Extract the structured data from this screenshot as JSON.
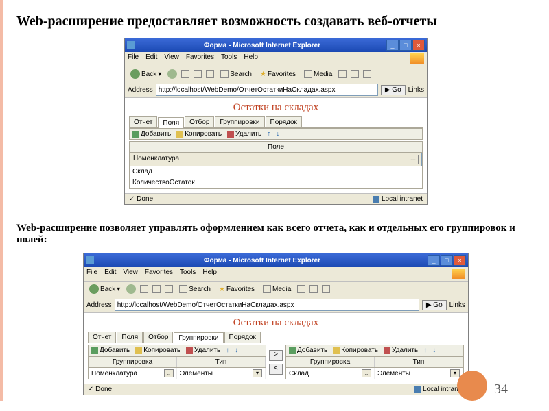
{
  "heading1": "Web-расширение предоставляет возможность создавать веб-отчеты",
  "heading2": "Web-расширение позволяет управлять оформлением как всего отчета, как и отдельных его группировок и полей:",
  "page_number": "34",
  "win1": {
    "title": "Форма - Microsoft Internet Explorer",
    "menu": [
      "File",
      "Edit",
      "View",
      "Favorites",
      "Tools",
      "Help"
    ],
    "toolbar": {
      "back": "Back",
      "search": "Search",
      "favorites": "Favorites",
      "media": "Media"
    },
    "addr_label": "Address",
    "url": "http://localhost/WebDemo/ОтчетОстаткиНаСкладах.aspx",
    "go": "Go",
    "links": "Links",
    "page_title": "Остатки на складах",
    "tabs": [
      "Отчет",
      "Поля",
      "Отбор",
      "Группировки",
      "Порядок"
    ],
    "active_tab": 1,
    "actions": {
      "add": "Добавить",
      "copy": "Копировать",
      "del": "Удалить"
    },
    "field_header": "Поле",
    "rows": [
      "Номенклатура",
      "Склад",
      "КоличествоОстаток"
    ],
    "status_done": "Done",
    "status_zone": "Local intranet"
  },
  "win2": {
    "title": "Форма - Microsoft Internet Explorer",
    "menu": [
      "File",
      "Edit",
      "View",
      "Favorites",
      "Tools",
      "Help"
    ],
    "toolbar": {
      "back": "Back",
      "search": "Search",
      "favorites": "Favorites",
      "media": "Media"
    },
    "addr_label": "Address",
    "url": "http://localhost/WebDemo/ОтчетОстаткиНаСкладах.aspx",
    "go": "Go",
    "links": "Links",
    "page_title": "Остатки на складах",
    "tabs": [
      "Отчет",
      "Поля",
      "Отбор",
      "Группировки",
      "Порядок"
    ],
    "active_tab": 3,
    "actions": {
      "add": "Добавить",
      "copy": "Копировать",
      "del": "Удалить"
    },
    "cols": {
      "group": "Группировка",
      "type": "Тип"
    },
    "left_row": {
      "group": "Номенклатура",
      "type": "Элементы"
    },
    "right_row": {
      "group": "Склад",
      "type": "Элементы"
    },
    "status_done": "Done",
    "status_zone": "Local intranet"
  }
}
